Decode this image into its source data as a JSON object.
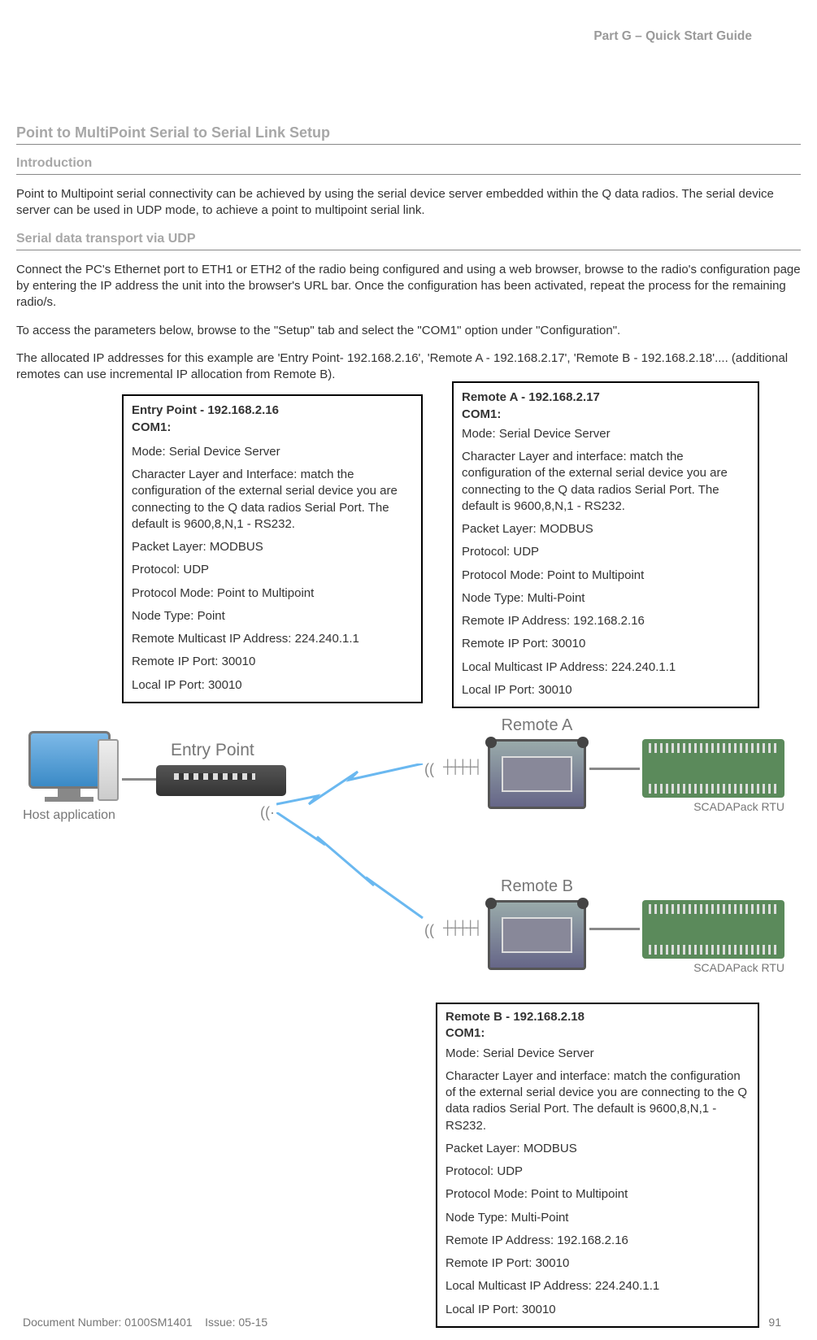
{
  "header": {
    "part_title": "Part G – Quick Start Guide"
  },
  "h1": "Point to MultiPoint Serial to Serial Link Setup",
  "h2_intro": "Introduction",
  "intro_para": "Point to Multipoint serial connectivity can be achieved by using the serial device server embedded within the Q data radios. The serial device server can be used in UDP mode, to achieve a point to multipoint serial link.",
  "h2_serial": "Serial data transport via UDP",
  "para1": "Connect the PC's Ethernet port to ETH1 or ETH2 of the radio being configured and using a web browser, browse to the radio's configuration page by entering the IP address the unit into the browser's URL bar.  Once the configuration has been activated, repeat the process for the remaining radio/s.",
  "para2": "To access the parameters below, browse to the \"Setup\" tab and select the \"COM1\" option under \"Configuration\".",
  "para3": "The allocated IP addresses for this example are 'Entry Point- 192.168.2.16', 'Remote A - 192.168.2.17', 'Remote B - 192.168.2.18'.... (additional remotes can use incremental IP allocation from Remote B).",
  "entry_point": {
    "title": "Entry Point - 192.168.2.16",
    "subtitle": "COM1:",
    "lines": [
      "Mode: Serial Device Server",
      "Character Layer and Interface: match the configuration of the external serial device you are connecting to the Q data radios Serial Port. The default is 9600,8,N,1 - RS232.",
      "Packet Layer: MODBUS",
      "Protocol: UDP",
      "Protocol Mode: Point to Multipoint",
      "Node Type: Point",
      "Remote Multicast IP Address: 224.240.1.1",
      "Remote IP Port: 30010",
      "Local IP Port: 30010"
    ]
  },
  "remote_a": {
    "title": "Remote A - 192.168.2.17",
    "subtitle": "COM1:",
    "lines": [
      "Mode: Serial Device Server",
      "Character Layer and interface: match the configuration of the external serial device you are connecting to the Q data radios Serial Port. The default is 9600,8,N,1 - RS232.",
      "Packet Layer: MODBUS",
      "Protocol: UDP",
      "Protocol Mode: Point to Multipoint",
      "Node Type: Multi-Point",
      "Remote IP Address: 192.168.2.16",
      "Remote IP Port: 30010",
      "Local Multicast IP Address: 224.240.1.1",
      "Local IP Port: 30010"
    ]
  },
  "remote_b": {
    "title": "Remote B - 192.168.2.18",
    "subtitle": "COM1:",
    "lines": [
      "Mode: Serial Device Server",
      "Character Layer and interface: match the configuration of the external serial device you are connecting to the Q data radios Serial Port. The default is 9600,8,N,1 - RS232.",
      "Packet Layer: MODBUS",
      "Protocol: UDP",
      "Protocol Mode: Point to Multipoint",
      "Node Type: Multi-Point",
      "Remote IP Address: 192.168.2.16",
      "Remote IP Port: 30010",
      "Local Multicast IP Address: 224.240.1.1",
      "Local IP Port: 30010"
    ]
  },
  "diagram": {
    "host_label": "Host application",
    "entry_label": "Entry Point",
    "remote_a_label": "Remote A",
    "remote_b_label": "Remote B",
    "rtu_label": "SCADAPack RTU"
  },
  "footer": {
    "doc": "Document Number: 0100SM1401",
    "issue": "Issue: 05-15",
    "page": "91"
  }
}
